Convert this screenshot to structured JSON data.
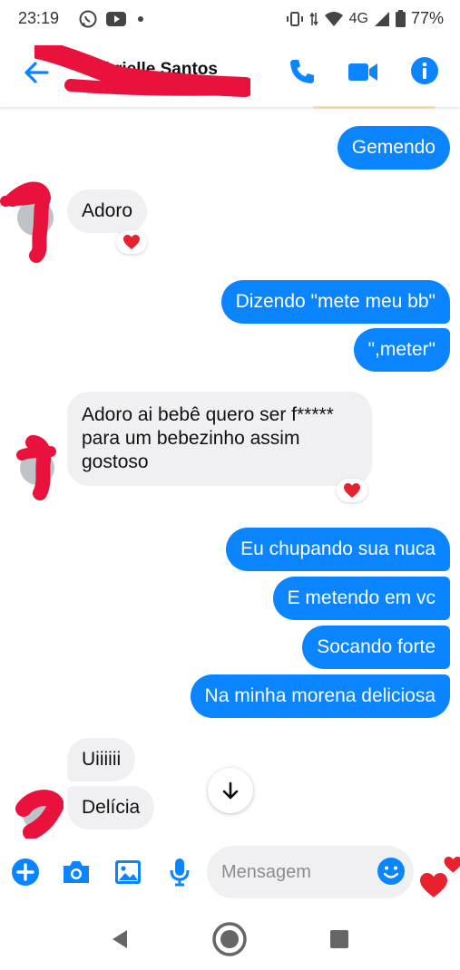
{
  "status_bar": {
    "time": "23:19",
    "network": "4G",
    "battery": "77%",
    "icons": [
      "whatsapp-icon",
      "youtube-icon",
      "dot-icon",
      "vibrate-icon",
      "data-arrows-icon",
      "wifi-icon",
      "signal-icon",
      "battery-icon"
    ]
  },
  "header": {
    "contact_name": "Gabrielle Santos",
    "icons": [
      "back-arrow-icon",
      "phone-icon",
      "video-icon",
      "info-icon"
    ]
  },
  "messages": [
    {
      "id": "m1",
      "direction": "sent",
      "text": "Gemendo"
    },
    {
      "id": "m2",
      "direction": "received",
      "text": "Adoro",
      "reaction": "heart"
    },
    {
      "id": "m3",
      "direction": "sent",
      "text": "Dizendo \"mete meu bb\""
    },
    {
      "id": "m4",
      "direction": "sent",
      "text": "\",meter\""
    },
    {
      "id": "m5",
      "direction": "received",
      "text": "Adoro ai bebê quero ser f***** para um bebezinho assim gostoso",
      "reaction": "heart"
    },
    {
      "id": "m6",
      "direction": "sent",
      "text": "Eu chupando sua nuca"
    },
    {
      "id": "m7",
      "direction": "sent",
      "text": "E metendo em vc"
    },
    {
      "id": "m8",
      "direction": "sent",
      "text": "Socando forte"
    },
    {
      "id": "m9",
      "direction": "sent",
      "text": "Na minha morena deliciosa"
    },
    {
      "id": "m10",
      "direction": "received",
      "text": "Uiiiiii"
    },
    {
      "id": "m11",
      "direction": "received",
      "text": "Delícia"
    }
  ],
  "composer": {
    "placeholder": "Mensagem",
    "icons": [
      "plus-icon",
      "camera-icon",
      "gallery-icon",
      "microphone-icon",
      "emoji-icon",
      "hearts-icon"
    ]
  },
  "colors": {
    "accent": "#0a84ff",
    "received_bubble": "#f0f0f2",
    "heart": "#e8212e",
    "redaction": "#e8123c"
  }
}
